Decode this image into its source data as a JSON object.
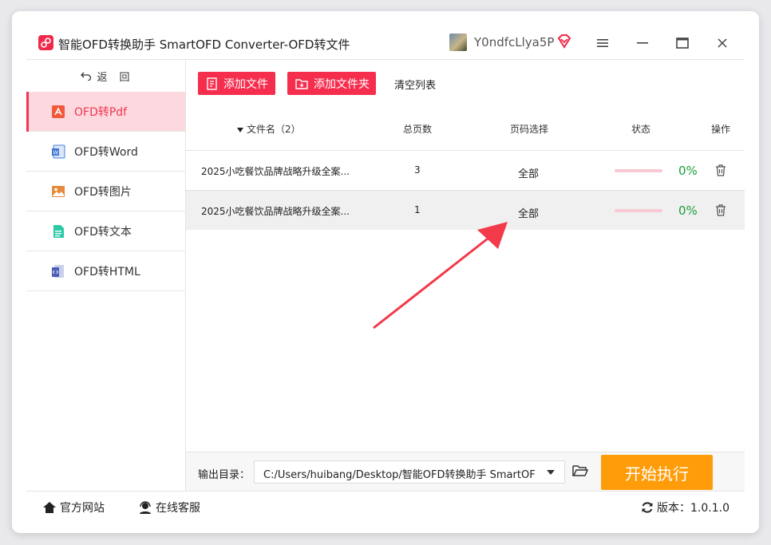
{
  "app": {
    "title": "智能OFD转换助手 SmartOFD Converter-OFD转文件",
    "user_name": "Y0ndfcLlya5P"
  },
  "sidebar": {
    "back_label": "返　回",
    "items": [
      {
        "label": "OFD转Pdf",
        "icon": "pdf-icon",
        "active": true
      },
      {
        "label": "OFD转Word",
        "icon": "word-icon",
        "active": false
      },
      {
        "label": "OFD转图片",
        "icon": "image-icon",
        "active": false
      },
      {
        "label": "OFD转文本",
        "icon": "text-icon",
        "active": false
      },
      {
        "label": "OFD转HTML",
        "icon": "html-icon",
        "active": false
      }
    ]
  },
  "toolbar": {
    "add_file": "添加文件",
    "add_folder": "添加文件夹",
    "clear_list": "清空列表"
  },
  "table": {
    "columns": [
      "文件名（2）",
      "总页数",
      "页码选择",
      "状态",
      "操作"
    ],
    "rows": [
      {
        "name": "2025小吃餐饮品牌战略升级全案...",
        "pages": "3",
        "range": "全部",
        "progress": 0,
        "percent": "0%"
      },
      {
        "name": "2025小吃餐饮品牌战略升级全案...",
        "pages": "1",
        "range": "全部",
        "progress": 0,
        "percent": "0%"
      }
    ]
  },
  "output": {
    "label": "输出目录：",
    "path": "C:/Users/huibang/Desktop/智能OFD转换助手 SmartOFD",
    "start_button": "开始执行"
  },
  "footer": {
    "official_site": "官方网站",
    "online_service": "在线客服",
    "version": "版本：1.0.1.0"
  },
  "colors": {
    "accent": "#f62e4e",
    "active_bg": "#fdd8de",
    "start_button": "#ff9c0a",
    "progress_pct": "#1a9e3a"
  }
}
